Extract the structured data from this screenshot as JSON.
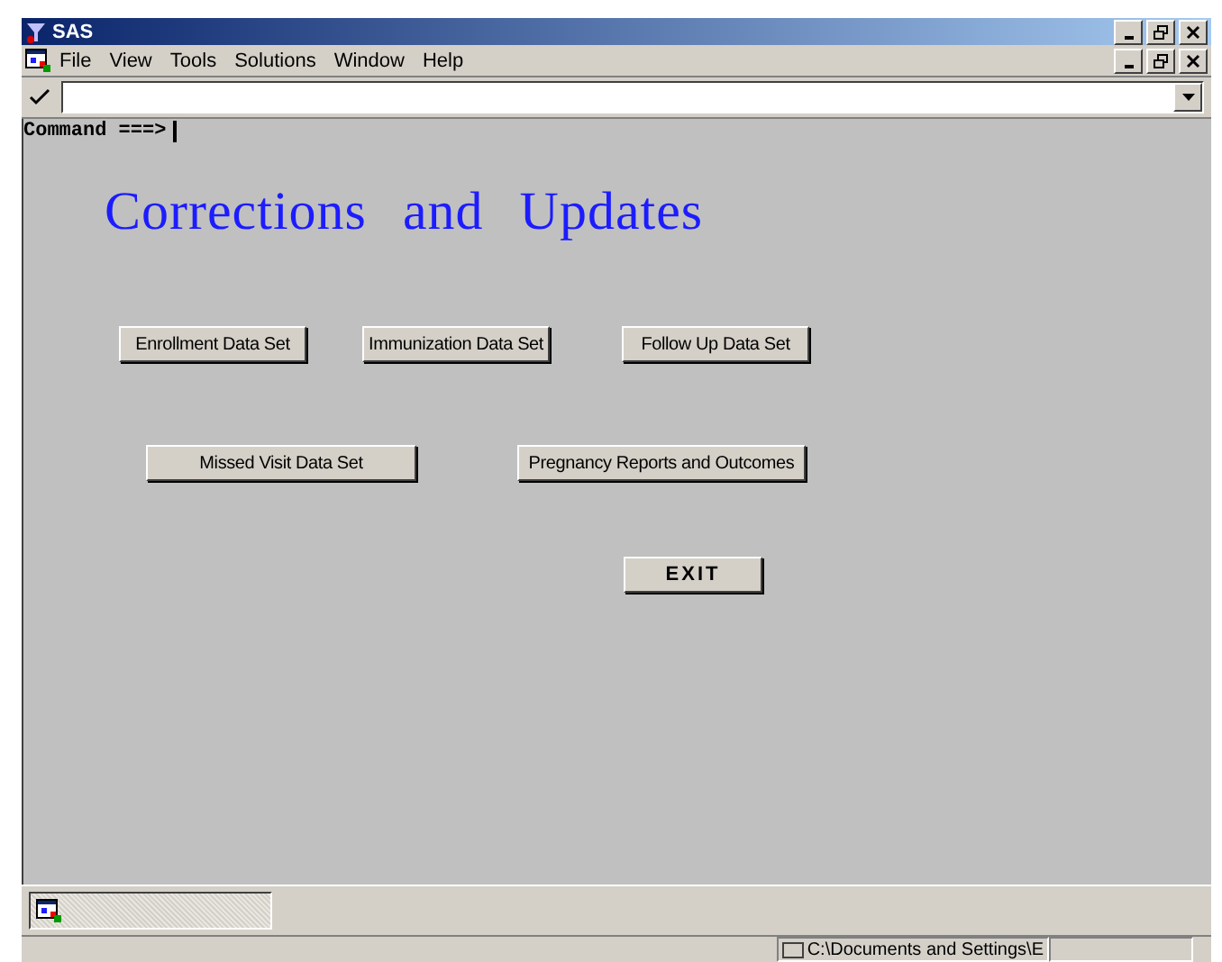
{
  "window": {
    "title": "SAS"
  },
  "menu": [
    "File",
    "View",
    "Tools",
    "Solutions",
    "Window",
    "Help"
  ],
  "command": {
    "label": "Command ===>"
  },
  "frame": {
    "heading": "Corrections and Updates",
    "button_rows": [
      [
        "Enrollment Data Set",
        "Immunization Data Set",
        "Follow Up Data Set"
      ],
      [
        "Missed Visit Data Set",
        "Pregnancy Reports and Outcomes"
      ],
      [
        "EXIT"
      ]
    ]
  },
  "status_bar": {
    "path": "C:\\Documents and Settings\\E"
  }
}
